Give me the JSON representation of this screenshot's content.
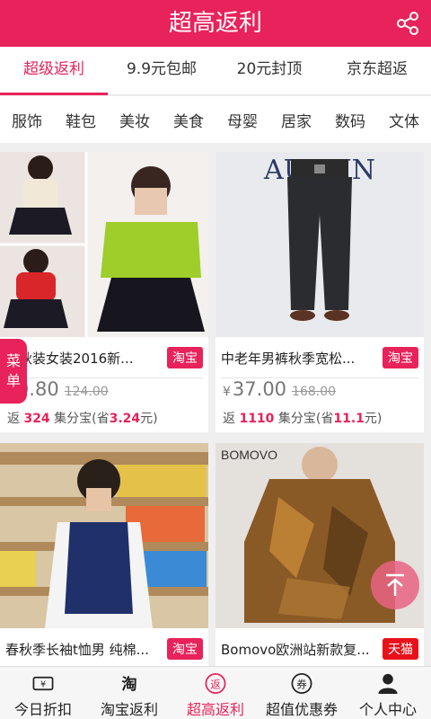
{
  "header": {
    "title": "超高返利"
  },
  "top_tabs": [
    {
      "label": "超级返利"
    },
    {
      "label": "9.9元包邮"
    },
    {
      "label": "20元封顶"
    },
    {
      "label": "京东超返"
    }
  ],
  "categories": [
    "服饰",
    "鞋包",
    "美妆",
    "美食",
    "母婴",
    "居家",
    "数码",
    "文体"
  ],
  "menu_tab": {
    "line1": "菜",
    "line2": "单"
  },
  "products": [
    {
      "title": "码秋装女装2016新...",
      "platform": "淘宝",
      "yen": "¥",
      "price": "0.80",
      "orig_price": "124.00",
      "rebate_prefix": "返 ",
      "rebate_points": "324",
      "rebate_mid": " 集分宝(省",
      "rebate_save": "3.24",
      "rebate_suffix": "元)"
    },
    {
      "title": "中老年男裤秋季宽松...",
      "platform": "淘宝",
      "yen": "¥",
      "price": "37.00",
      "orig_price": "168.00",
      "rebate_prefix": "返 ",
      "rebate_points": "1110",
      "rebate_mid": " 集分宝(省",
      "rebate_save": "11.1",
      "rebate_suffix": "元)"
    },
    {
      "title": "春秋季长袖t恤男 纯棉...",
      "platform": "淘宝"
    },
    {
      "title": "Bomovo欧洲站新款复...",
      "platform": "天猫",
      "img_text": "BOMOVO"
    }
  ],
  "product_images": {
    "p2_brand": "AUTMN"
  },
  "bottom_nav": [
    {
      "label": "今日折扣",
      "icon": "discount-ticket-icon"
    },
    {
      "label": "淘宝返利",
      "icon": "taobao-icon",
      "icon_text": "淘"
    },
    {
      "label": "超高返利",
      "icon": "rebate-icon",
      "icon_text": "返"
    },
    {
      "label": "超值优惠券",
      "icon": "coupon-icon",
      "icon_text": "券"
    },
    {
      "label": "个人中心",
      "icon": "user-icon"
    }
  ],
  "colors": {
    "accent": "#e8225a",
    "tmall": "#e8111a"
  }
}
